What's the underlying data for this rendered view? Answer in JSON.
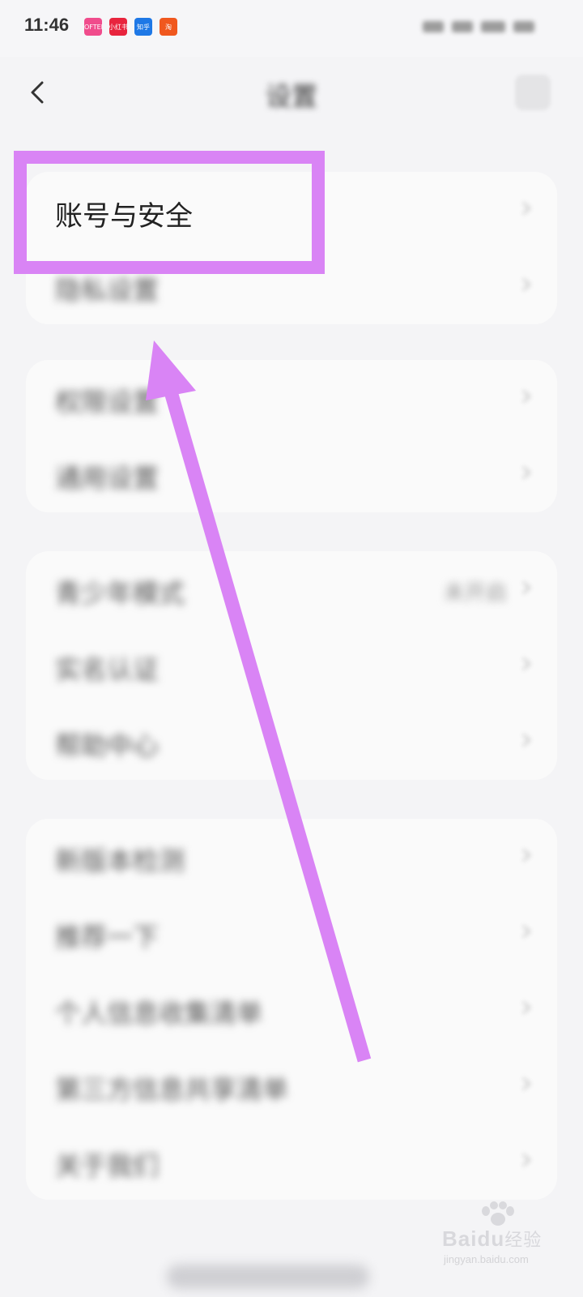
{
  "status_bar": {
    "time": "11:46",
    "app_icons": [
      {
        "name": "lofter-app",
        "label": "LOFTER",
        "color": "#f04c8c"
      },
      {
        "name": "xiaohongshu-app",
        "label": "小红书",
        "color": "#e8243d"
      },
      {
        "name": "zhihu-app",
        "label": "知乎",
        "color": "#1e78e6"
      },
      {
        "name": "taobao-app",
        "label": "淘",
        "color": "#f0581e"
      }
    ]
  },
  "nav": {
    "title": "设置",
    "back_icon": "chevron-left-icon"
  },
  "groups": [
    {
      "rows": [
        {
          "label": "账号与安全",
          "value": ""
        },
        {
          "label": "隐私设置",
          "value": ""
        }
      ]
    },
    {
      "rows": [
        {
          "label": "权限设置",
          "value": ""
        },
        {
          "label": "通用设置",
          "value": ""
        }
      ]
    },
    {
      "rows": [
        {
          "label": "青少年模式",
          "value": "未开启"
        },
        {
          "label": "实名认证",
          "value": ""
        },
        {
          "label": "帮助中心",
          "value": ""
        }
      ]
    },
    {
      "rows": [
        {
          "label": "新版本检测",
          "value": ""
        },
        {
          "label": "推荐一下",
          "value": ""
        },
        {
          "label": "个人信息收集清单",
          "value": ""
        },
        {
          "label": "第三方信息共享清单",
          "value": ""
        },
        {
          "label": "关于我们",
          "value": ""
        }
      ]
    }
  ],
  "watermark": {
    "brand": "Baidu",
    "brand_cn": "经验",
    "url": "jingyan.baidu.com"
  },
  "colors": {
    "highlight": "#d984f5",
    "background": "#f4f4f6",
    "card": "#fafafa"
  }
}
